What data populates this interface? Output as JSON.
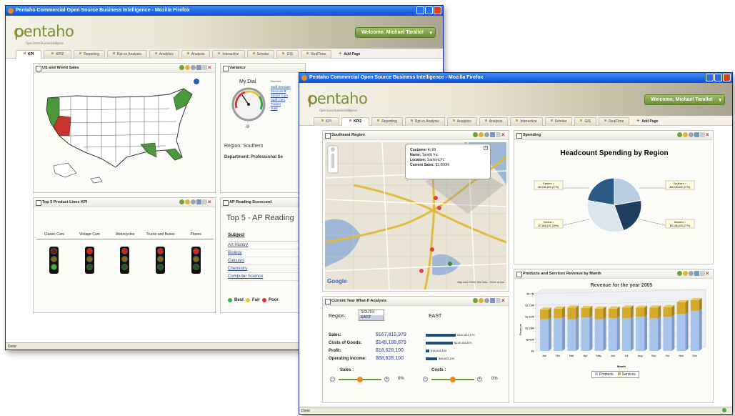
{
  "back_window": {
    "title": "Pentaho Commercial Open Source Business Intelligence - Mozilla Firefox",
    "logo": "pentaho",
    "tagline": "Open Source Business Intelligence",
    "welcome": "Welcome, Michael Tarallo!",
    "tabs": [
      "KPI",
      "KPI2",
      "Reporting",
      "Rpt vs Analysis",
      "Analytics",
      "Analysis",
      "Interactive",
      "Scholar",
      "GIS",
      "RealTime",
      "Add Page"
    ],
    "panels": {
      "us_sales": {
        "title": "US and World Sales"
      },
      "variance": {
        "title": "Variance",
        "dial_title": "My Dial",
        "dial_value": "-9",
        "region": "Region: Southern",
        "department": "Department: Professional Se",
        "number_label": "Number",
        "list": [
          "Staff Services",
          "Services B",
          "Server Com",
          "Staff Com",
          "Trainer",
          "Total"
        ]
      },
      "top5": {
        "title": "Top 5 Product Lines KPI",
        "labels": [
          "Classic Cars",
          "Vintage Cars",
          "Motorcycles",
          "Trucks and Buses",
          "Planes"
        ]
      },
      "ap": {
        "title": "AP Reading Scorecard",
        "heading": "Top 5 - AP Reading",
        "subject_label": "Subject",
        "subjects": [
          "Art History",
          "Biology",
          "Calculus",
          "Chemistry",
          "Computer Science"
        ],
        "legend": [
          "Best",
          "Fair",
          "Poor"
        ]
      }
    },
    "status": "Done"
  },
  "front_window": {
    "title": "Pentaho Commercial Open Source Business Intelligence - Mozilla Firefox",
    "logo": "pentaho",
    "tagline": "Open Source Business Intelligence",
    "welcome": "Welcome, Michael Tarallo!",
    "tabs": [
      "KPI",
      "KPI2",
      "Reporting",
      "Rpt vs Analysis",
      "Analytics",
      "Analysis",
      "Interactive",
      "Scholar",
      "GIS",
      "RealTime",
      "Add Page"
    ],
    "panels": {
      "map": {
        "title": "Southeast Region",
        "popup": [
          [
            "Customer #:",
            "99"
          ],
          [
            "Name:",
            "Tarallo Inc"
          ],
          [
            "Location:",
            "Sanford,FL"
          ],
          [
            "Current Sales:",
            "$1,000M"
          ]
        ],
        "google": "Google",
        "copyright": "Map data ©2008 Tele Atlas - Terms of Use"
      },
      "spending": {
        "title": "Spending",
        "chart_title": "Headcount Spending by Region",
        "labels": [
          "Eastern =\n$5,246,640 (27%)",
          "Southern =\n$5,246,640 (27%)",
          "Central =\n$7,865,192 (39%)",
          "Western =\n$5,246,640 (27%)"
        ]
      },
      "whatif": {
        "title": "Current Year What-If Analysis",
        "region_label": "Region:",
        "region_options": [
          "SOUTH",
          "EAST"
        ],
        "region_value": "EAST",
        "rows": [
          [
            "Sales:",
            "$167,816,979",
            "$167,816,979"
          ],
          [
            "Costs of Goods:",
            "$149,188,879",
            "$149,188,879"
          ],
          [
            "Profit:",
            "$18,628,100",
            "$18,628,100"
          ],
          [
            "Operating Income:",
            "$68,628,100",
            "$68,628,100"
          ]
        ],
        "sales_label": "Sales :",
        "costs_label": "Costs :",
        "sales_pct": "0%",
        "costs_pct": "0%"
      },
      "revenue": {
        "title": "Products and Services Revenue by Month",
        "legend": [
          "Products",
          "Services"
        ]
      }
    },
    "status": "Done"
  },
  "chart_data": [
    {
      "type": "pie",
      "title": "Headcount Spending by Region",
      "categories": [
        "Eastern",
        "Southern",
        "Central",
        "Western"
      ],
      "values": [
        5246640,
        5246640,
        7865192,
        5246640
      ],
      "labels": [
        "27%",
        "27%",
        "39%",
        "27%"
      ],
      "colors": [
        "#b8cde0",
        "#1f3f60",
        "#dce6ef",
        "#2c5a86"
      ]
    },
    {
      "type": "bar",
      "title": "Revenue for the year 2005",
      "xlabel": "Month",
      "ylabel": "Revenue",
      "categories": [
        "Jan",
        "Feb",
        "Mar",
        "Apr",
        "May",
        "Jun",
        "Jul",
        "Aug",
        "Sep",
        "Oct",
        "Nov",
        "Dec"
      ],
      "yticks": [
        "$0",
        "$540M",
        "$1.08M",
        "$1.62M",
        "$2.16M",
        "$2.7M"
      ],
      "ylim": [
        0,
        2.7
      ],
      "series": [
        {
          "name": "Products",
          "values": [
            1.5,
            1.55,
            1.5,
            1.58,
            1.5,
            1.55,
            1.55,
            1.62,
            1.55,
            1.62,
            1.75,
            1.9
          ]
        },
        {
          "name": "Services",
          "values": [
            0.45,
            0.45,
            0.55,
            0.45,
            0.5,
            0.45,
            0.5,
            0.42,
            0.5,
            0.45,
            0.55,
            0.5
          ]
        }
      ],
      "colors": {
        "Products": "#a8c4ea",
        "Services": "#d4a92c"
      }
    }
  ]
}
